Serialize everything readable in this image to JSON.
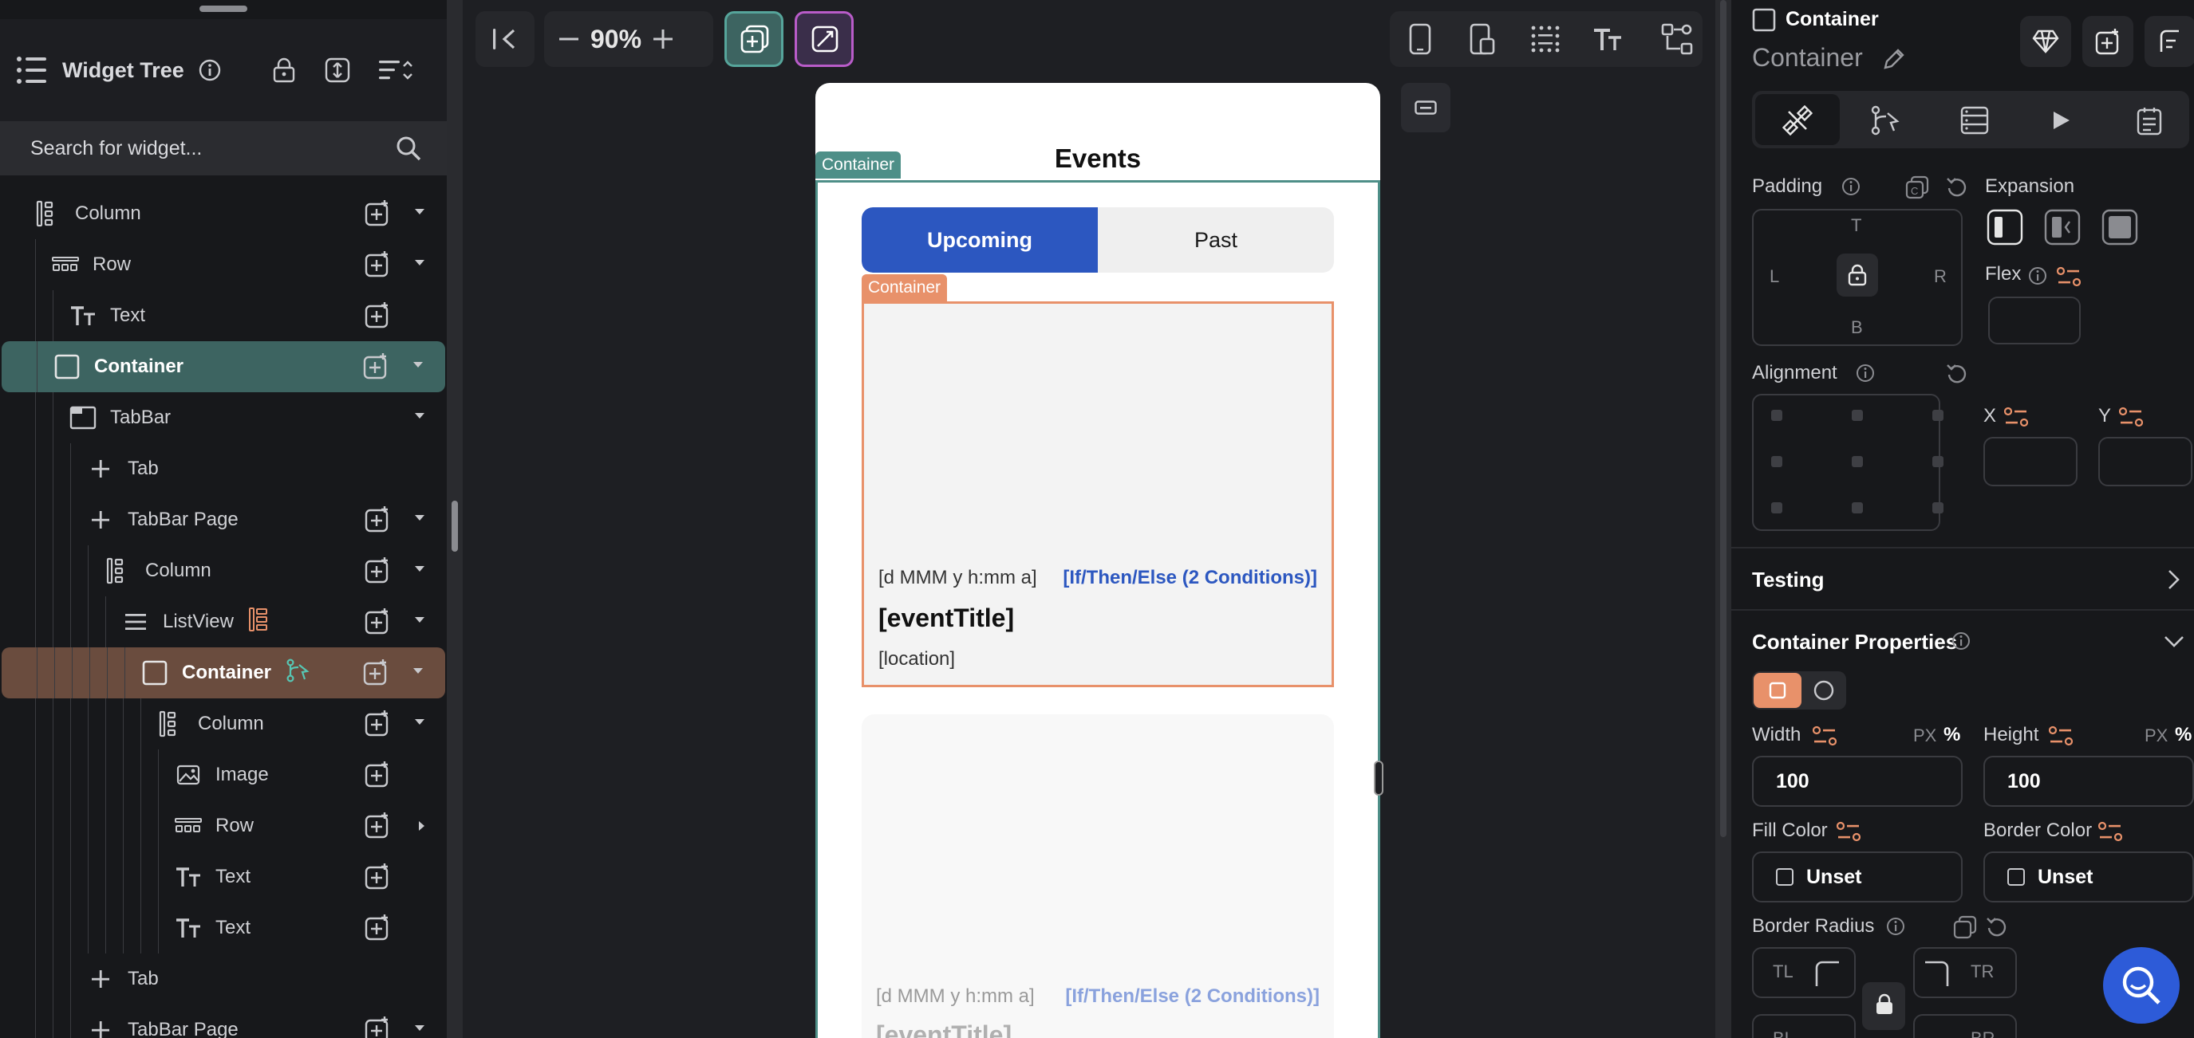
{
  "left_panel": {
    "title": "Widget Tree",
    "search_placeholder": "Search for widget...",
    "tree": [
      {
        "label": "Column",
        "icon": "column-icon",
        "indent": 1
      },
      {
        "label": "Row",
        "icon": "row-icon",
        "indent": 2
      },
      {
        "label": "Text",
        "icon": "text-icon",
        "indent": 3
      },
      {
        "label": "Container",
        "icon": "container-icon",
        "indent": 2,
        "selected": "green"
      },
      {
        "label": "TabBar",
        "icon": "tabbar-icon",
        "indent": 3
      },
      {
        "label": "Tab",
        "icon": "plus-icon",
        "indent": 4
      },
      {
        "label": "TabBar Page",
        "icon": "plus-icon",
        "indent": 4
      },
      {
        "label": "Column",
        "icon": "column-icon",
        "indent": 5
      },
      {
        "label": "ListView",
        "icon": "listview-icon",
        "indent": 6
      },
      {
        "label": "Container",
        "icon": "container-icon",
        "indent": 7,
        "selected": "brown"
      },
      {
        "label": "Column",
        "icon": "column-icon",
        "indent": 8
      },
      {
        "label": "Image",
        "icon": "image-icon",
        "indent": 9
      },
      {
        "label": "Row",
        "icon": "row-icon",
        "indent": 9
      },
      {
        "label": "Text",
        "icon": "text-icon",
        "indent": 9
      },
      {
        "label": "Text",
        "icon": "text-icon",
        "indent": 9
      },
      {
        "label": "Tab",
        "icon": "plus-icon",
        "indent": 4
      },
      {
        "label": "TabBar Page",
        "icon": "plus-icon",
        "indent": 4
      }
    ]
  },
  "toolbar": {
    "zoom": "90%"
  },
  "canvas": {
    "page_title": "Events",
    "outer_tag": "Container",
    "inner_tag": "Container",
    "tabs": [
      "Upcoming",
      "Past"
    ],
    "card": {
      "date": "[d MMM y h:mm a]",
      "condition": "[If/Then/Else (2 Conditions)]",
      "title": "[eventTitle]",
      "location": "[location]"
    },
    "card2": {
      "date": "[d MMM y h:mm a]",
      "condition": "[If/Then/Else (2 Conditions)]",
      "title": "[eventTitle]"
    }
  },
  "right_panel": {
    "widget_type": "Container",
    "widget_name": "Container",
    "padding": {
      "label": "Padding",
      "t": "T",
      "l": "L",
      "r": "R",
      "b": "B"
    },
    "expansion_label": "Expansion",
    "flex_label": "Flex",
    "alignment_label": "Alignment",
    "x_label": "X",
    "y_label": "Y",
    "testing_label": "Testing",
    "container_props_label": "Container Properties",
    "width": {
      "label": "Width",
      "unit_px": "PX",
      "unit_pct": "%",
      "value": "100"
    },
    "height": {
      "label": "Height",
      "unit_px": "PX",
      "unit_pct": "%",
      "value": "100"
    },
    "fill_color": {
      "label": "Fill Color",
      "value": "Unset"
    },
    "border_color": {
      "label": "Border Color",
      "value": "Unset"
    },
    "border_radius": {
      "label": "Border Radius",
      "tl": "TL",
      "tr": "TR",
      "bl": "BL",
      "br": "BR"
    }
  },
  "colors": {
    "accent_green": "#4e8f88",
    "accent_orange": "#e8916a",
    "tab_active": "#2c57c0",
    "panel_bg": "#17181b"
  }
}
